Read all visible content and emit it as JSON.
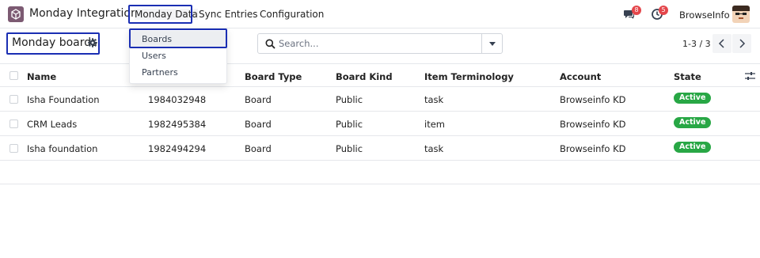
{
  "app": {
    "name": "Monday Integration",
    "menus": [
      "Monday Data",
      "Sync Entries",
      "Configuration"
    ],
    "company": "BrowseInfo",
    "chat_badge": "8",
    "activity_badge": "5"
  },
  "dropdown": {
    "items": [
      "Boards",
      "Users",
      "Partners"
    ]
  },
  "control": {
    "title": "Monday boards",
    "search_placeholder": "Search...",
    "pager": "1-3 / 3"
  },
  "table": {
    "columns": [
      "Name",
      "Board Type",
      "Board Kind",
      "Item Terminology",
      "Account",
      "State"
    ],
    "rows": [
      {
        "name": "Isha Foundation",
        "id": "1984032948",
        "board_type": "Board",
        "board_kind": "Public",
        "terminology": "task",
        "account": "Browseinfo KD",
        "state": "Active"
      },
      {
        "name": "CRM Leads",
        "id": "1982495384",
        "board_type": "Board",
        "board_kind": "Public",
        "terminology": "item",
        "account": "Browseinfo KD",
        "state": "Active"
      },
      {
        "name": "Isha foundation",
        "id": "1982494294",
        "board_type": "Board",
        "board_kind": "Public",
        "terminology": "task",
        "account": "Browseinfo KD",
        "state": "Active"
      }
    ]
  },
  "colors": {
    "highlight_box": "#1a2eb3",
    "badge_red": "#e4464b",
    "status_active": "#28a745"
  }
}
